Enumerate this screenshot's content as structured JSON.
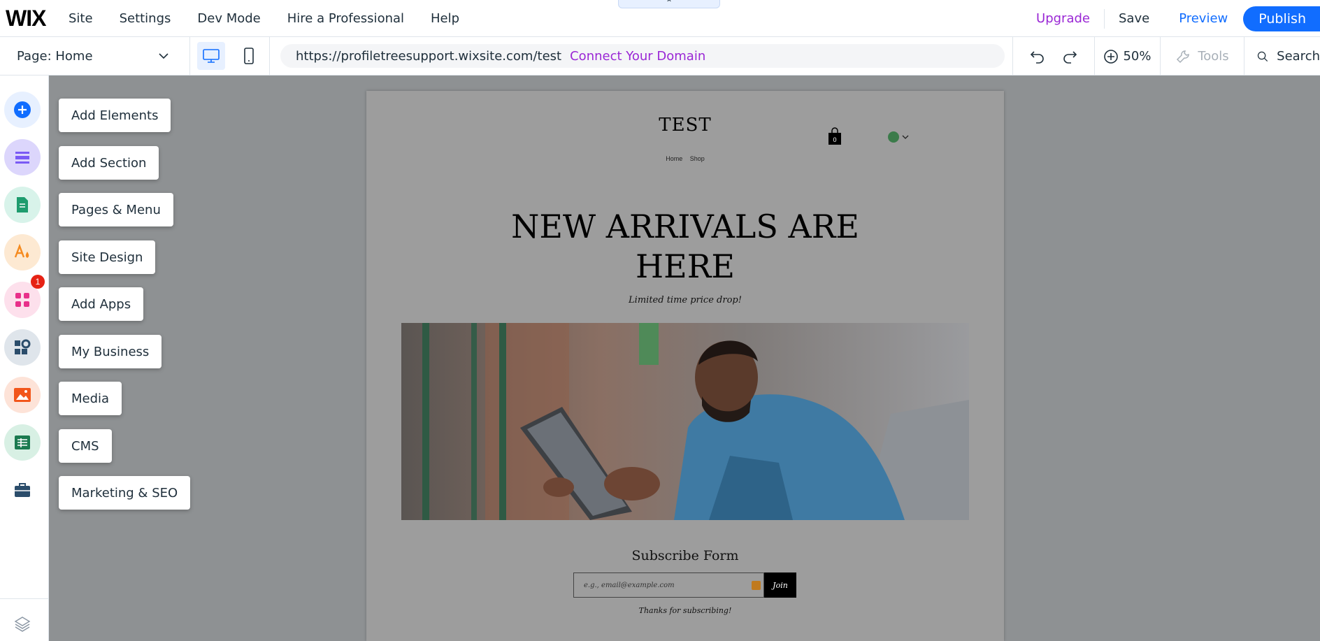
{
  "app": {
    "logo": "WIX"
  },
  "topmenu": {
    "items": [
      "Site",
      "Settings",
      "Dev Mode",
      "Hire a Professional",
      "Help"
    ],
    "collapse_glyph": "⌃",
    "upgrade": "Upgrade",
    "save": "Save",
    "preview": "Preview",
    "publish": "Publish"
  },
  "toolbar": {
    "page_label": "Page: Home",
    "url": "https://profiletreesupport.wixsite.com/test",
    "connect_domain": "Connect Your Domain",
    "zoom": "50%",
    "tools": "Tools",
    "search": "Search"
  },
  "rail": {
    "icons": [
      "add-elements-icon",
      "add-section-icon",
      "pages-menu-icon",
      "site-design-icon",
      "add-apps-icon",
      "my-business-icon",
      "media-icon",
      "cms-icon",
      "marketing-seo-icon",
      "layers-icon"
    ],
    "apps_badge": "1"
  },
  "addmenu": {
    "items": [
      "Add Elements",
      "Add Section",
      "Pages & Menu",
      "Site Design",
      "Add Apps",
      "My Business",
      "Media",
      "CMS",
      "Marketing & SEO"
    ]
  },
  "site": {
    "title": "TEST",
    "nav": [
      "Home",
      "Shop"
    ],
    "cart_count": "0",
    "heading": "NEW ARRIVALS ARE HERE",
    "subheading": "Limited time price drop!",
    "form_title": "Subscribe Form",
    "email_placeholder": "e.g., email@example.com",
    "join_label": "Join",
    "thanks": "Thanks for subscribing!"
  },
  "colors": {
    "accent_blue": "#116dff",
    "upgrade_purple": "#9a27d5",
    "stage_gray": "#8e9193"
  }
}
